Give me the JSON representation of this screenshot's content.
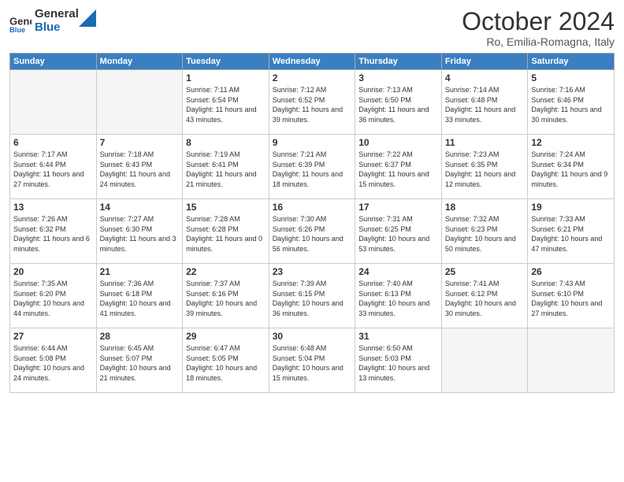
{
  "header": {
    "logo_general": "General",
    "logo_blue": "Blue",
    "month_title": "October 2024",
    "location": "Ro, Emilia-Romagna, Italy"
  },
  "weekdays": [
    "Sunday",
    "Monday",
    "Tuesday",
    "Wednesday",
    "Thursday",
    "Friday",
    "Saturday"
  ],
  "weeks": [
    [
      {
        "day": "",
        "info": ""
      },
      {
        "day": "",
        "info": ""
      },
      {
        "day": "1",
        "info": "Sunrise: 7:11 AM\nSunset: 6:54 PM\nDaylight: 11 hours and 43 minutes."
      },
      {
        "day": "2",
        "info": "Sunrise: 7:12 AM\nSunset: 6:52 PM\nDaylight: 11 hours and 39 minutes."
      },
      {
        "day": "3",
        "info": "Sunrise: 7:13 AM\nSunset: 6:50 PM\nDaylight: 11 hours and 36 minutes."
      },
      {
        "day": "4",
        "info": "Sunrise: 7:14 AM\nSunset: 6:48 PM\nDaylight: 11 hours and 33 minutes."
      },
      {
        "day": "5",
        "info": "Sunrise: 7:16 AM\nSunset: 6:46 PM\nDaylight: 11 hours and 30 minutes."
      }
    ],
    [
      {
        "day": "6",
        "info": "Sunrise: 7:17 AM\nSunset: 6:44 PM\nDaylight: 11 hours and 27 minutes."
      },
      {
        "day": "7",
        "info": "Sunrise: 7:18 AM\nSunset: 6:43 PM\nDaylight: 11 hours and 24 minutes."
      },
      {
        "day": "8",
        "info": "Sunrise: 7:19 AM\nSunset: 6:41 PM\nDaylight: 11 hours and 21 minutes."
      },
      {
        "day": "9",
        "info": "Sunrise: 7:21 AM\nSunset: 6:39 PM\nDaylight: 11 hours and 18 minutes."
      },
      {
        "day": "10",
        "info": "Sunrise: 7:22 AM\nSunset: 6:37 PM\nDaylight: 11 hours and 15 minutes."
      },
      {
        "day": "11",
        "info": "Sunrise: 7:23 AM\nSunset: 6:35 PM\nDaylight: 11 hours and 12 minutes."
      },
      {
        "day": "12",
        "info": "Sunrise: 7:24 AM\nSunset: 6:34 PM\nDaylight: 11 hours and 9 minutes."
      }
    ],
    [
      {
        "day": "13",
        "info": "Sunrise: 7:26 AM\nSunset: 6:32 PM\nDaylight: 11 hours and 6 minutes."
      },
      {
        "day": "14",
        "info": "Sunrise: 7:27 AM\nSunset: 6:30 PM\nDaylight: 11 hours and 3 minutes."
      },
      {
        "day": "15",
        "info": "Sunrise: 7:28 AM\nSunset: 6:28 PM\nDaylight: 11 hours and 0 minutes."
      },
      {
        "day": "16",
        "info": "Sunrise: 7:30 AM\nSunset: 6:26 PM\nDaylight: 10 hours and 56 minutes."
      },
      {
        "day": "17",
        "info": "Sunrise: 7:31 AM\nSunset: 6:25 PM\nDaylight: 10 hours and 53 minutes."
      },
      {
        "day": "18",
        "info": "Sunrise: 7:32 AM\nSunset: 6:23 PM\nDaylight: 10 hours and 50 minutes."
      },
      {
        "day": "19",
        "info": "Sunrise: 7:33 AM\nSunset: 6:21 PM\nDaylight: 10 hours and 47 minutes."
      }
    ],
    [
      {
        "day": "20",
        "info": "Sunrise: 7:35 AM\nSunset: 6:20 PM\nDaylight: 10 hours and 44 minutes."
      },
      {
        "day": "21",
        "info": "Sunrise: 7:36 AM\nSunset: 6:18 PM\nDaylight: 10 hours and 41 minutes."
      },
      {
        "day": "22",
        "info": "Sunrise: 7:37 AM\nSunset: 6:16 PM\nDaylight: 10 hours and 39 minutes."
      },
      {
        "day": "23",
        "info": "Sunrise: 7:39 AM\nSunset: 6:15 PM\nDaylight: 10 hours and 36 minutes."
      },
      {
        "day": "24",
        "info": "Sunrise: 7:40 AM\nSunset: 6:13 PM\nDaylight: 10 hours and 33 minutes."
      },
      {
        "day": "25",
        "info": "Sunrise: 7:41 AM\nSunset: 6:12 PM\nDaylight: 10 hours and 30 minutes."
      },
      {
        "day": "26",
        "info": "Sunrise: 7:43 AM\nSunset: 6:10 PM\nDaylight: 10 hours and 27 minutes."
      }
    ],
    [
      {
        "day": "27",
        "info": "Sunrise: 6:44 AM\nSunset: 5:08 PM\nDaylight: 10 hours and 24 minutes."
      },
      {
        "day": "28",
        "info": "Sunrise: 6:45 AM\nSunset: 5:07 PM\nDaylight: 10 hours and 21 minutes."
      },
      {
        "day": "29",
        "info": "Sunrise: 6:47 AM\nSunset: 5:05 PM\nDaylight: 10 hours and 18 minutes."
      },
      {
        "day": "30",
        "info": "Sunrise: 6:48 AM\nSunset: 5:04 PM\nDaylight: 10 hours and 15 minutes."
      },
      {
        "day": "31",
        "info": "Sunrise: 6:50 AM\nSunset: 5:03 PM\nDaylight: 10 hours and 13 minutes."
      },
      {
        "day": "",
        "info": ""
      },
      {
        "day": "",
        "info": ""
      }
    ]
  ]
}
